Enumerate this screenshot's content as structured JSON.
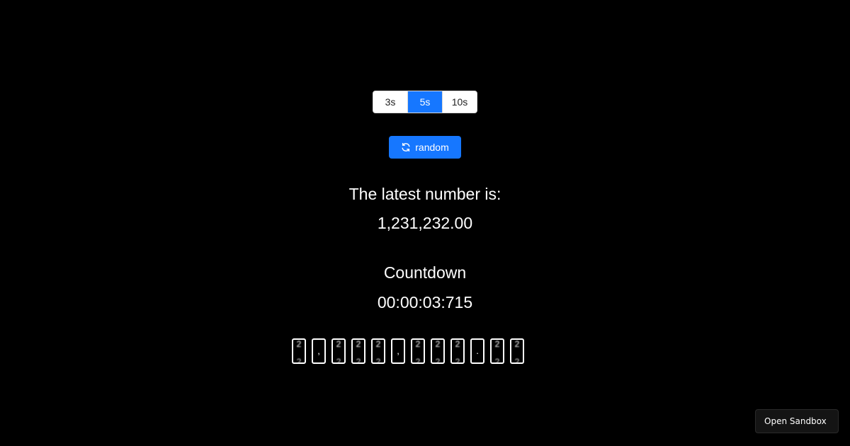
{
  "interval_selector": {
    "options": [
      {
        "label": "3s",
        "active": false
      },
      {
        "label": "5s",
        "active": true
      },
      {
        "label": "10s",
        "active": false
      }
    ]
  },
  "random_button": {
    "label": "random",
    "icon": "refresh-icon"
  },
  "latest": {
    "heading": "The latest number is:",
    "value": "1,231,232.00"
  },
  "countdown": {
    "heading": "Countdown",
    "value": "00:00:03:715"
  },
  "digit_roller": {
    "chars": [
      "2",
      ",",
      "2",
      "2",
      "2",
      ",",
      "2",
      "2",
      "2",
      ".",
      "2",
      "2"
    ]
  },
  "sandbox": {
    "label": "Open Sandbox"
  },
  "colors": {
    "background": "#000000",
    "accent": "#1677ff",
    "text": "#ffffff"
  }
}
